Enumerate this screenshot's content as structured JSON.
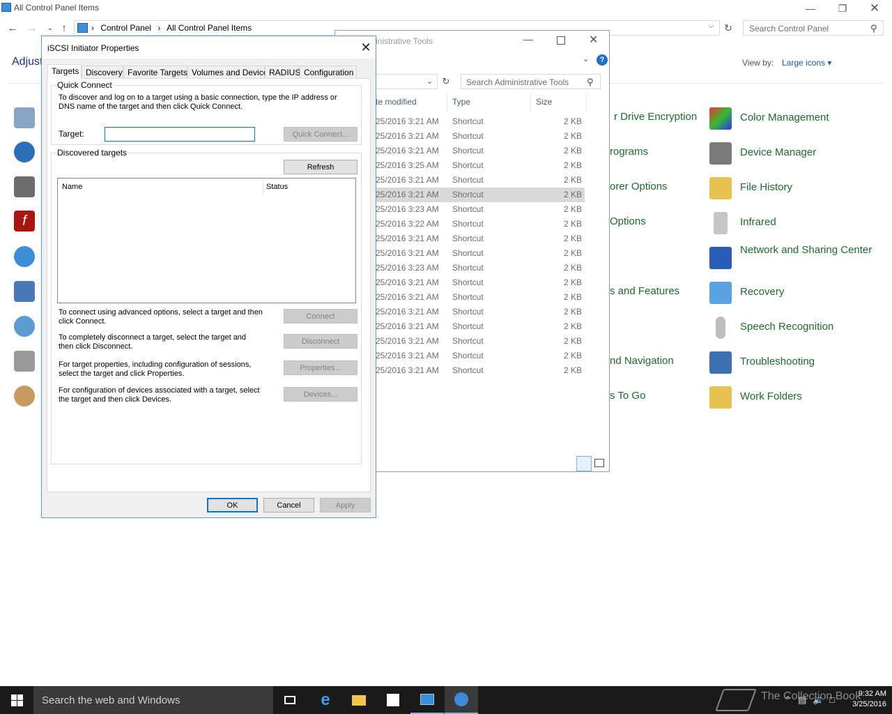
{
  "control_panel": {
    "title": "All Control Panel Items",
    "breadcrumbs": [
      "Control Panel",
      "All Control Panel Items"
    ],
    "search_placeholder": "Search Control Panel",
    "heading_partial": "Adjust",
    "view_by_label": "View by:",
    "view_by_value": "Large icons",
    "partial_items": [
      "r Drive Encryption",
      "rograms",
      "orer Options",
      "Options",
      "s and Features",
      "nd Navigation",
      "s To Go"
    ],
    "right_items": [
      "Color Management",
      "Device Manager",
      "File History",
      "Infrared",
      "Network and Sharing Center",
      "Recovery",
      "Speech Recognition",
      "Troubleshooting",
      "Work Folders"
    ]
  },
  "admin_tools": {
    "title_partial": "inistrative Tools",
    "search_placeholder": "Search Administrative Tools",
    "columns": [
      "te modified",
      "Type",
      "Size"
    ],
    "rows": [
      {
        "date": "25/2016 3:21 AM",
        "type": "Shortcut",
        "size": "2 KB"
      },
      {
        "date": "25/2016 3:21 AM",
        "type": "Shortcut",
        "size": "2 KB"
      },
      {
        "date": "25/2016 3:21 AM",
        "type": "Shortcut",
        "size": "2 KB"
      },
      {
        "date": "25/2016 3:25 AM",
        "type": "Shortcut",
        "size": "2 KB"
      },
      {
        "date": "25/2016 3:21 AM",
        "type": "Shortcut",
        "size": "2 KB"
      },
      {
        "date": "25/2016 3:21 AM",
        "type": "Shortcut",
        "size": "2 KB"
      },
      {
        "date": "25/2016 3:23 AM",
        "type": "Shortcut",
        "size": "2 KB"
      },
      {
        "date": "25/2016 3:22 AM",
        "type": "Shortcut",
        "size": "2 KB"
      },
      {
        "date": "25/2016 3:21 AM",
        "type": "Shortcut",
        "size": "2 KB"
      },
      {
        "date": "25/2016 3:21 AM",
        "type": "Shortcut",
        "size": "2 KB"
      },
      {
        "date": "25/2016 3:23 AM",
        "type": "Shortcut",
        "size": "2 KB"
      },
      {
        "date": "25/2016 3:21 AM",
        "type": "Shortcut",
        "size": "2 KB"
      },
      {
        "date": "25/2016 3:21 AM",
        "type": "Shortcut",
        "size": "2 KB"
      },
      {
        "date": "25/2016 3:21 AM",
        "type": "Shortcut",
        "size": "2 KB"
      },
      {
        "date": "25/2016 3:21 AM",
        "type": "Shortcut",
        "size": "2 KB"
      },
      {
        "date": "25/2016 3:21 AM",
        "type": "Shortcut",
        "size": "2 KB"
      },
      {
        "date": "25/2016 3:21 AM",
        "type": "Shortcut",
        "size": "2 KB"
      },
      {
        "date": "25/2016 3:21 AM",
        "type": "Shortcut",
        "size": "2 KB"
      }
    ]
  },
  "dialog": {
    "title": "iSCSI Initiator Properties",
    "tabs": [
      "Targets",
      "Discovery",
      "Favorite Targets",
      "Volumes and Devices",
      "RADIUS",
      "Configuration"
    ],
    "quick_connect": {
      "group_label": "Quick Connect",
      "description": "To discover and log on to a target using a basic connection, type the IP address or DNS name of the target and then click Quick Connect.",
      "target_label": "Target:",
      "target_value": "",
      "button": "Quick Connect..."
    },
    "discovered": {
      "group_label": "Discovered targets",
      "refresh_button": "Refresh",
      "col_name": "Name",
      "col_status": "Status"
    },
    "actions": [
      {
        "text": "To connect using advanced options, select a target and then click Connect.",
        "button": "Connect"
      },
      {
        "text": "To completely disconnect a target, select the target and then click Disconnect.",
        "button": "Disconnect"
      },
      {
        "text": "For target properties, including configuration of sessions, select the target and click Properties.",
        "button": "Properties..."
      },
      {
        "text": "For configuration of devices associated with a target, select the target and then click Devices.",
        "button": "Devices..."
      }
    ],
    "ok": "OK",
    "cancel": "Cancel",
    "apply": "Apply"
  },
  "taskbar": {
    "search_placeholder": "Search the web and Windows",
    "watermark": "The Collection Book",
    "time": "9:32 AM",
    "date": "3/25/2016"
  },
  "colors": {
    "accent": "#0078d7",
    "link_green": "#1e6b2e",
    "taskbar": "#1a1a1a"
  }
}
